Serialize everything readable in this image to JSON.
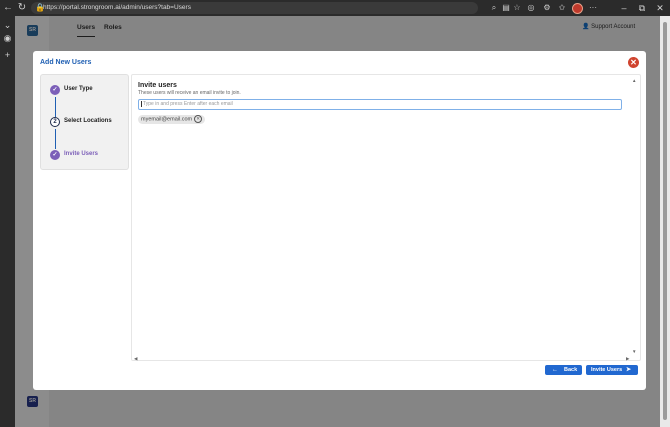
{
  "browser": {
    "url": "https://portal.strongroom.ai/admin/users?tab=Users",
    "back_icon": "arrow-left-icon",
    "refresh_icon": "refresh-icon"
  },
  "app": {
    "tabs": [
      "Users",
      "Roles"
    ],
    "support_label": "Support Account",
    "logo_text": "SR"
  },
  "modal": {
    "title": "Add New Users",
    "steps": [
      {
        "number": "1",
        "label": "User Type",
        "state": "done"
      },
      {
        "number": "2",
        "label": "Select Locations",
        "state": "current"
      },
      {
        "number": "3",
        "label": "Invite Users",
        "state": "active"
      }
    ],
    "invite": {
      "heading": "Invite users",
      "subheading": "These users will receive an email invite to join.",
      "placeholder": "Type in and press Enter after each email",
      "emails": [
        "myemail@email.com"
      ]
    },
    "buttons": {
      "back": "Back",
      "invite": "Invite Users"
    }
  },
  "colors": {
    "accent": "#2168d0",
    "step_done": "#7c5fb8",
    "close": "#d0442f"
  }
}
